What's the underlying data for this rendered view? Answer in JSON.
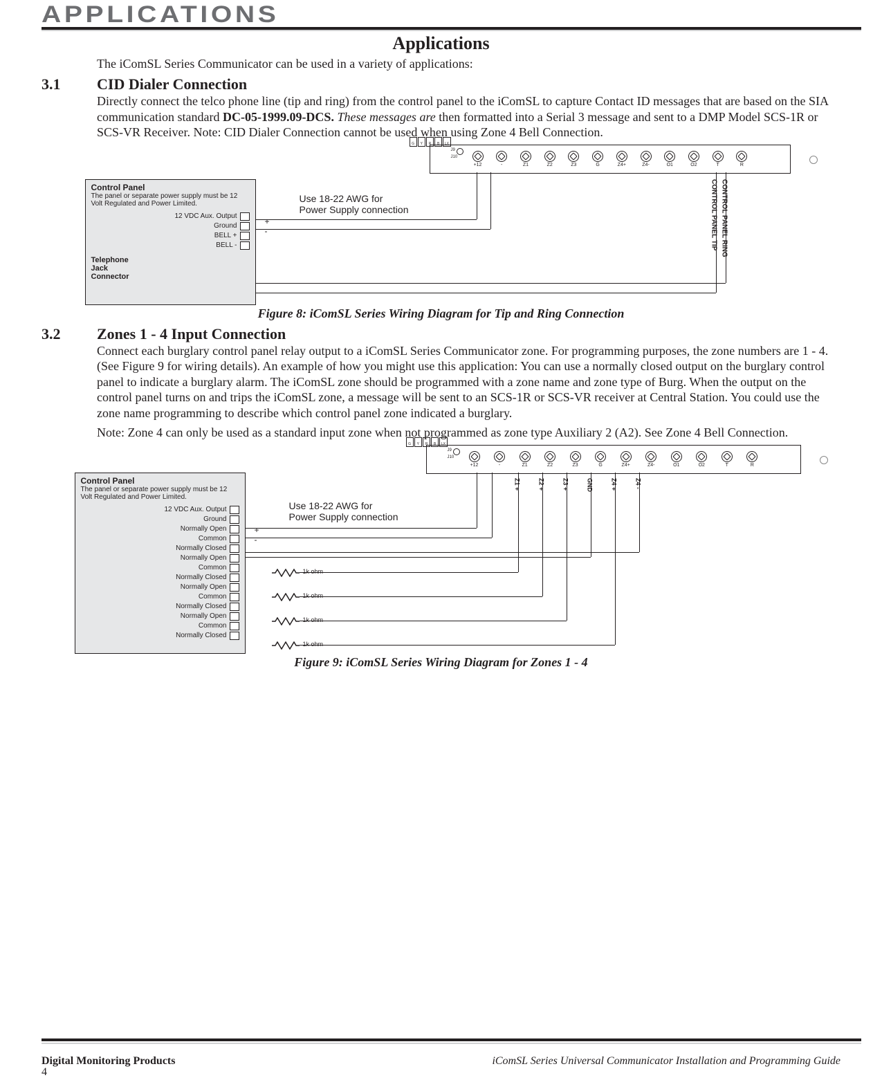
{
  "header": {
    "tab": "APPLICATIONS"
  },
  "page": {
    "title": "Applications",
    "intro": "The iComSL Series Communicator can be used in a variety of applications:"
  },
  "sections": [
    {
      "num": "3.1",
      "title": "CID Dialer Connection",
      "body_a": "Directly connect the telco phone line (tip and ring) from the control panel to the iComSL to capture Contact ID messages that are based on the SIA communication standard ",
      "body_bold": "DC-05-1999.09-DCS.",
      "body_italic": " These messages are",
      "body_b": " then formatted into a Serial 3 message and sent to a DMP Model SCS-1R or SCS-VR Receiver. Note: CID Dialer Connection cannot be used when using Zone 4 Bell Connection."
    },
    {
      "num": "3.2",
      "title": "Zones 1 - 4 Input Connection",
      "body_a": "Connect each burglary control panel relay output to a iComSL Series Communicator zone. For programming purposes, the zone numbers are 1 - 4. (See Figure 9 for wiring details). An example of how you might use this application: You can use a normally closed output on the burglary control panel to indicate a burglary alarm. The iComSL zone should be programmed with a zone name and zone type of Burg. When the output on the control panel turns on and trips the iComSL zone, a message will be sent to an SCS-1R or SCS-VR receiver at Central Station. You could use the zone name programming to describe which control panel zone indicated a burglary.",
      "body_b": "Note: Zone 4 can only be used as a standard input zone when not programmed as zone type Auxiliary 2 (A2). See Zone 4 Bell Connection."
    }
  ],
  "figures": {
    "fig8_caption": "Figure 8: iComSL Series Wiring Diagram for Tip and Ring Connection",
    "fig9_caption": "Figure 9: iComSL Series Wiring Diagram for Zones 1 - 4"
  },
  "diagram_common": {
    "panel_title": "Control Panel",
    "panel_note": "The panel or separate power supply must be 12 Volt Regulated and Power Limited.",
    "awg_note_l1": "Use 18-22 AWG for",
    "awg_note_l2": "Power Supply connection",
    "reset_pins": [
      "G",
      "Y",
      "R",
      "B",
      "LX"
    ],
    "board_terms": [
      "+12",
      "-",
      "Z1",
      "Z2",
      "Z3",
      "G",
      "Z4+",
      "Z4-",
      "O1",
      "O2",
      "T",
      "R"
    ],
    "jumpers": {
      "j9": "J9",
      "j10": "J10"
    }
  },
  "fig8": {
    "panel_terms": [
      "12 VDC Aux. Output",
      "Ground",
      "BELL +",
      "BELL -"
    ],
    "phone_jack": "Telephone\nJack\nConnector",
    "side_labels": {
      "ring": "CONTROL PANEL RING",
      "tip": "CONTROL PANEL TIP"
    },
    "plus": "+",
    "minus": "-"
  },
  "fig9": {
    "panel_terms": [
      "12 VDC Aux. Output",
      "Ground",
      "Normally Open",
      "Common",
      "Normally Closed",
      "Normally Open",
      "Common",
      "Normally Closed",
      "Normally Open",
      "Common",
      "Normally Closed",
      "Normally Open",
      "Common",
      "Normally Closed"
    ],
    "zone_labels": [
      "Z1 +",
      "Z2 +",
      "Z3 +",
      "GND",
      "Z4 +",
      "Z4 -"
    ],
    "resistor_label": "1k ohm",
    "plus": "+",
    "minus": "-"
  },
  "footer": {
    "left": "Digital Monitoring Products",
    "right": "iComSL Series Universal Communicator Installation and Programming Guide",
    "page": "4"
  }
}
